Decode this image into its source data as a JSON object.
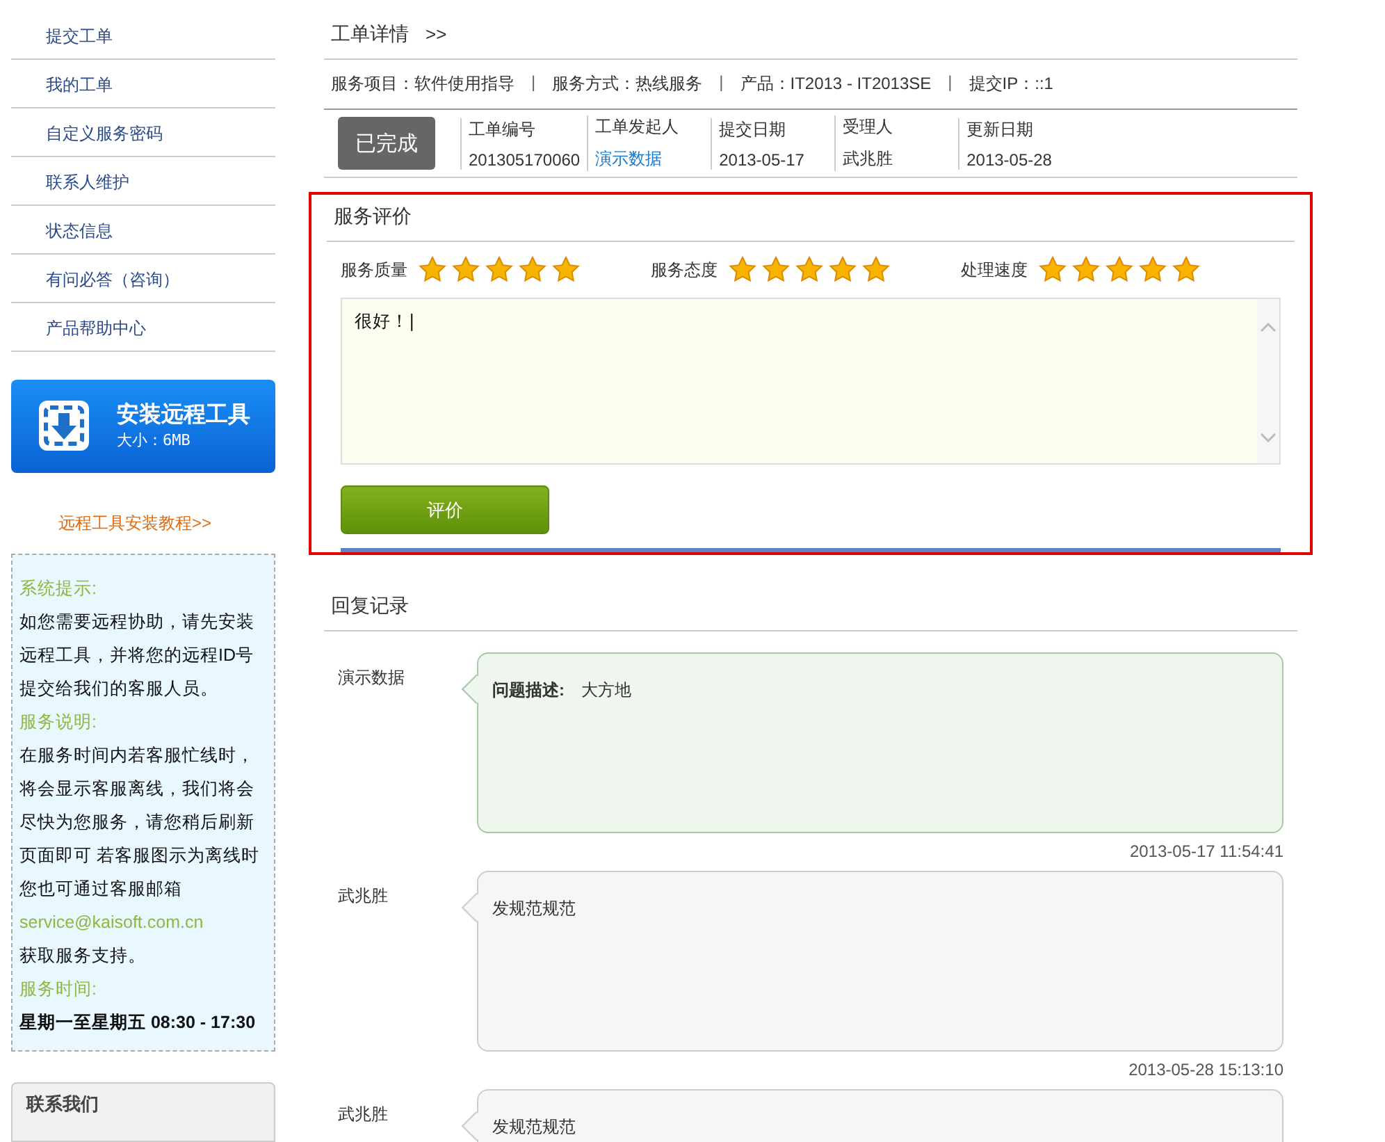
{
  "sidebar": {
    "nav_items": [
      {
        "label": "提交工单"
      },
      {
        "label": "我的工单"
      },
      {
        "label": "自定义服务密码"
      },
      {
        "label": "联系人维护"
      },
      {
        "label": "状态信息"
      },
      {
        "label": "有问必答（咨询）"
      },
      {
        "label": "产品帮助中心"
      }
    ],
    "install_button": {
      "title": "安装远程工具",
      "size": "大小：6MB"
    },
    "tutorial_link": "远程工具安装教程>>",
    "info_box": [
      {
        "kind": "heading",
        "text": "系统提示:"
      },
      {
        "kind": "text",
        "text": "如您需要远程协助，请先安装远程工具，并将您的远程ID号提交给我们的客服人员。"
      },
      {
        "kind": "heading",
        "text": "服务说明:"
      },
      {
        "kind": "text",
        "text": "在服务时间内若客服忙线时，将会显示客服离线，我们将会尽快为您服务，请您稍后刷新页面即可 若客服图示为离线时您也可通过客服邮箱"
      },
      {
        "kind": "email",
        "text": "service@kaisoft.com.cn"
      },
      {
        "kind": "text",
        "text": "获取服务支持。"
      },
      {
        "kind": "heading",
        "text": "服务时间:"
      },
      {
        "kind": "hours",
        "text": "星期一至星期五 08:30 - 17:30"
      }
    ],
    "contact_header": "联系我们"
  },
  "detail": {
    "title": "工单详情",
    "title_arrow": ">>",
    "meta": [
      "服务项目：软件使用指导",
      "服务方式：热线服务",
      "产品：IT2013 - IT2013SE",
      "提交IP：::1"
    ],
    "separator": "|",
    "status": "已完成",
    "fields": [
      {
        "label": "工单编号",
        "value": "201305170060",
        "link": false
      },
      {
        "label": "工单发起人",
        "value": "演示数据",
        "link": true
      },
      {
        "label": "提交日期",
        "value": "2013-05-17",
        "link": false
      },
      {
        "label": "受理人",
        "value": "武兆胜",
        "link": false
      },
      {
        "label": "更新日期",
        "value": "2013-05-28",
        "link": false
      }
    ]
  },
  "rating": {
    "title": "服务评价",
    "highlighted": true,
    "criteria": [
      {
        "label": "服务质量",
        "stars": 5
      },
      {
        "label": "服务态度",
        "stars": 5
      },
      {
        "label": "处理速度",
        "stars": 5
      }
    ],
    "comment": {
      "value": "很好！|"
    },
    "submit_button": "评价"
  },
  "replies": {
    "title": "回复记录",
    "items": [
      {
        "kind": "question",
        "author": "演示数据",
        "text": "**问题描述:**　大方地",
        "time": "2013-05-17 11:54:41"
      },
      {
        "kind": "reply",
        "author": "武兆胜",
        "text": "发规范规范",
        "time": "2013-05-28 15:13:10"
      },
      {
        "kind": "reply",
        "author": "武兆胜",
        "text": "发规范规范"
      }
    ]
  }
}
